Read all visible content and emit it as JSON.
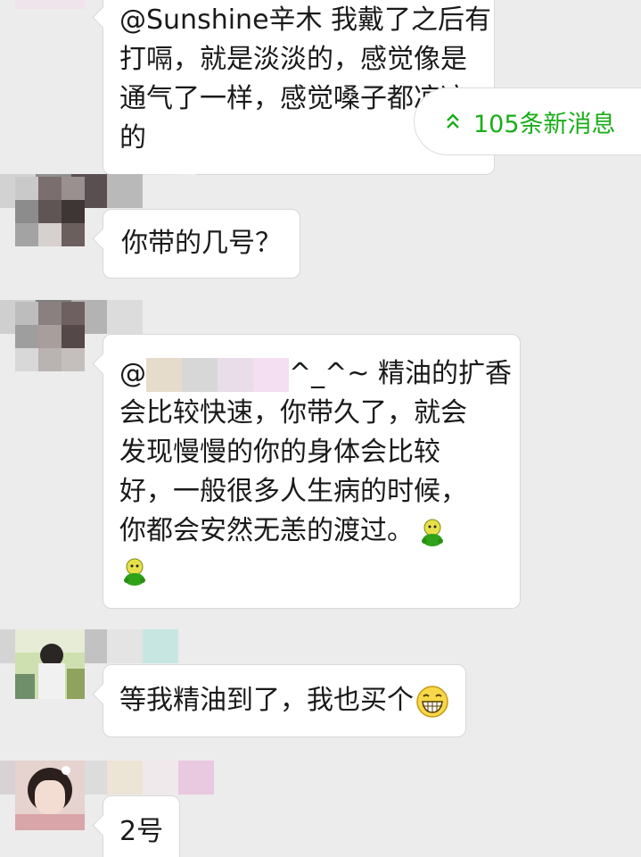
{
  "messages": [
    {
      "id": "msg1",
      "lines": [
        "@Sunshine辛木 我戴了之后有",
        "打嗝，就是淡淡的，感觉像是",
        "通气了一样，感觉嗓子都凉凉",
        "的"
      ]
    },
    {
      "id": "msg2",
      "text": "你带的几号？"
    },
    {
      "id": "msg3",
      "mention_prefix": "@",
      "first_line_tail": "^_^~ 精油的扩香",
      "lines": [
        "会比较快速，你带久了，就会",
        "发现慢慢的你的身体会比较",
        "好，一般很多人生病的时候，",
        "你都会安然无恙的渡过。"
      ],
      "emoji": "frog-emoji"
    },
    {
      "id": "msg4",
      "text": "等我精油到了，我也买个",
      "emoji": "grin-emoji"
    },
    {
      "id": "msg5",
      "text": "2号"
    }
  ],
  "new_messages": {
    "label": "105条新消息",
    "icon": "double-chevron-up-icon",
    "color": "#1aad19"
  }
}
